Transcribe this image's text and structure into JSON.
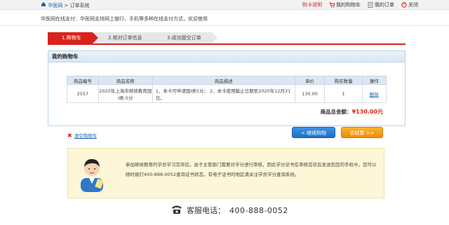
{
  "topbar": {
    "breadcrumb_home": "华医网",
    "breadcrumb_sep": " > ",
    "breadcrumb_current": "订单系统",
    "links": [
      "购卡说明",
      "我的购物车",
      "我的订单",
      "关闭"
    ]
  },
  "notice": "华医网在线支付：华医网支持网上银行、手机等多种在线支付方式，欢迎使用",
  "steps": [
    "1.购物车",
    "2.核对订单信息",
    "3.成功提交订单"
  ],
  "cart": {
    "title": "我的购物车",
    "columns": [
      "商品编号",
      "商品名称",
      "商品描述",
      "单价",
      "购买数量",
      "操作"
    ],
    "rows": [
      {
        "id": "2557",
        "name": "2020年上海市继续教育国I类-5分",
        "desc": "1、本卡可申请国I类5分；  2、本卡使用截止日期至2020年12月31日。",
        "price": "130.00",
        "qty": "1",
        "op": "删除"
      }
    ],
    "total_label": "商品总金额：",
    "total_value": "¥130.00元"
  },
  "actions": {
    "clear_label": "清空购物车",
    "continue_label": "< 继续购物",
    "settle_label": "去结算 >>"
  },
  "info_text": "参加继续教育的学员学习完毕后，由于主管部门需要对学分进行审核，因此学分证书在审核完毕后发送到您的手机中，您可以随时拨打400-888-0052查询证书状态，有电子证书的地区请关注学员学分查询系统。",
  "phone": {
    "label": "客服电话：",
    "number": "400-888-0052"
  },
  "colors": {
    "accent_red": "#d8231c",
    "link_blue": "#1a64b4",
    "btn_blue": "#1f6fc6",
    "btn_orange": "#f08a0b"
  }
}
